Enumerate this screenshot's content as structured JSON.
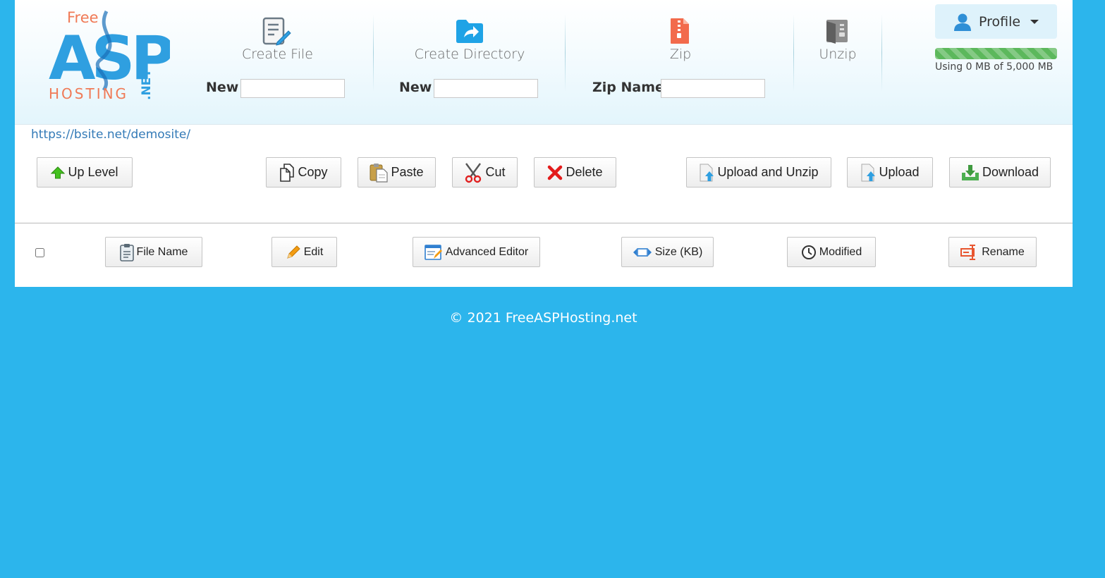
{
  "brand": {
    "logo_free": "Free",
    "logo_asp": "ASP",
    "logo_hosting": "HOSTING",
    "logo_net": ".NET"
  },
  "tools": {
    "create_file": {
      "title": "Create File",
      "label": "New",
      "value": ""
    },
    "create_directory": {
      "title": "Create Directory",
      "label": "New",
      "value": ""
    },
    "zip": {
      "title": "Zip",
      "label": "Zip Name",
      "value": ""
    },
    "unzip": {
      "title": "Unzip"
    }
  },
  "profile": {
    "label": "Profile",
    "usage_text": "Using 0 MB of 5,000 MB",
    "usage_fraction": 1.0
  },
  "current_path": "https://bsite.net/demosite/",
  "toolbar": {
    "up_level": "Up Level",
    "copy": "Copy",
    "paste": "Paste",
    "cut": "Cut",
    "delete": "Delete",
    "upload_unzip": "Upload and Unzip",
    "upload": "Upload",
    "download": "Download"
  },
  "columns": {
    "file_name": "File Name",
    "edit": "Edit",
    "advanced_editor": "Advanced Editor",
    "size": "Size (KB)",
    "modified": "Modified",
    "rename": "Rename"
  },
  "footer": "© 2021 FreeASPHosting.net",
  "colors": {
    "background": "#2cb5ec",
    "brand_blue": "#2f9fe0",
    "brand_orange": "#f07a56",
    "progress_green": "#5cb85c",
    "link": "#337ab7"
  }
}
